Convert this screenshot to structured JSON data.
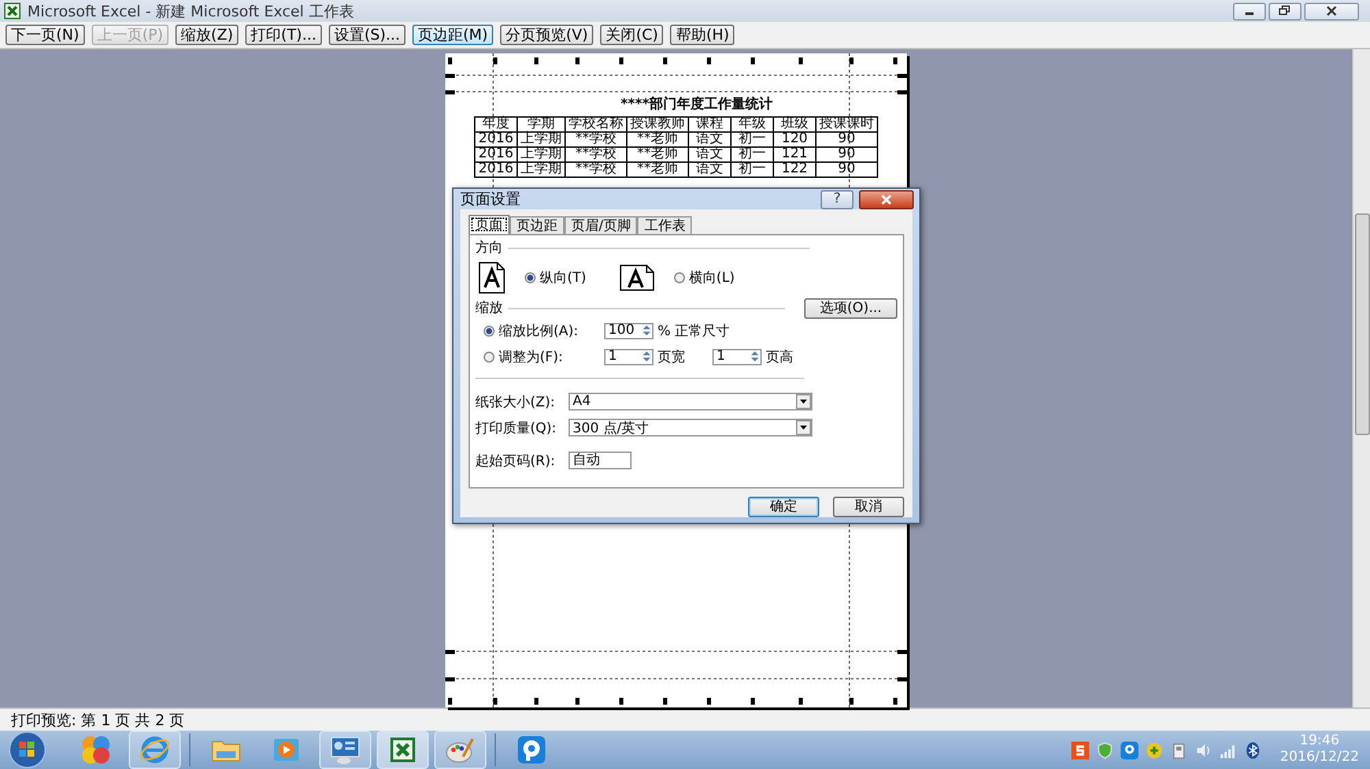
{
  "window": {
    "title": "Microsoft Excel - 新建 Microsoft Excel 工作表"
  },
  "toolbar": [
    {
      "label": "下一页(N)",
      "disabled": false,
      "pressed": false
    },
    {
      "label": "上一页(P)",
      "disabled": true,
      "pressed": false
    },
    {
      "label": "缩放(Z)",
      "disabled": false,
      "pressed": false
    },
    {
      "label": "打印(T)...",
      "disabled": false,
      "pressed": false
    },
    {
      "label": "设置(S)...",
      "disabled": false,
      "pressed": false
    },
    {
      "label": "页边距(M)",
      "disabled": false,
      "pressed": true
    },
    {
      "label": "分页预览(V)",
      "disabled": false,
      "pressed": false
    },
    {
      "label": "关闭(C)",
      "disabled": false,
      "pressed": false
    },
    {
      "label": "帮助(H)",
      "disabled": false,
      "pressed": false
    }
  ],
  "page": {
    "title": "****部门年度工作量统计",
    "columns": [
      "年度",
      "学期",
      "学校名称",
      "授课教师",
      "课程",
      "年级",
      "班级",
      "授课课时"
    ],
    "rows": [
      [
        "2016",
        "上学期",
        "**学校",
        "**老师",
        "语文",
        "初一",
        "120",
        "90"
      ],
      [
        "2016",
        "上学期",
        "**学校",
        "**老师",
        "语文",
        "初一",
        "121",
        "90"
      ],
      [
        "2016",
        "上学期",
        "**学校",
        "**老师",
        "语文",
        "初一",
        "122",
        "90"
      ]
    ]
  },
  "dialog": {
    "title": "页面设置",
    "help": "?",
    "tabs": [
      {
        "label": "页面",
        "selected": true
      },
      {
        "label": "页边距",
        "selected": false
      },
      {
        "label": "页眉/页脚",
        "selected": false
      },
      {
        "label": "工作表",
        "selected": false
      }
    ],
    "orientation": {
      "heading": "方向",
      "options": [
        {
          "label": "纵向(T)",
          "selected": true
        },
        {
          "label": "横向(L)",
          "selected": false
        }
      ]
    },
    "scaling": {
      "heading": "缩放",
      "options_button": "选项(O)...",
      "options": [
        {
          "kind": "percent",
          "label": "缩放比例(A):",
          "selected": true,
          "value": "100",
          "suffix": "% 正常尺寸"
        },
        {
          "kind": "fit",
          "label": "调整为(F):",
          "selected": false,
          "wide": "1",
          "wide_label": "页宽",
          "tall": "1",
          "tall_label": "页高"
        }
      ]
    },
    "fields": [
      {
        "kind": "select",
        "label": "纸张大小(Z):",
        "value": "A4"
      },
      {
        "kind": "select",
        "label": "打印质量(Q):",
        "value": "300 点/英寸"
      },
      {
        "kind": "input",
        "label": "起始页码(R):",
        "value": "自动"
      }
    ],
    "buttons": [
      {
        "label": "确定",
        "default": true
      },
      {
        "label": "取消",
        "default": false
      }
    ]
  },
  "status_bar": "打印预览: 第 1 页  共 2 页",
  "clock": {
    "time": "19:46",
    "date": "2016/12/22"
  }
}
